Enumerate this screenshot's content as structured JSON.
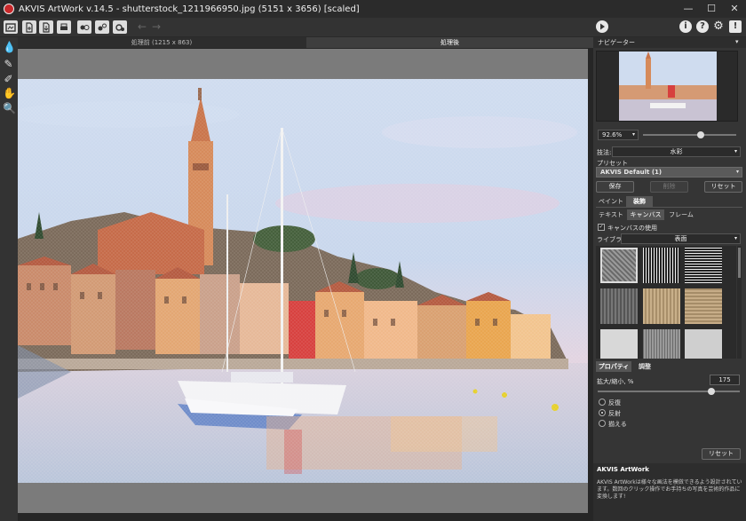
{
  "window": {
    "title": "AKVIS ArtWork v.14.5 - shutterstock_1211966950.jpg (5151 x 3656) [scaled]",
    "minimize": "—",
    "maximize": "☐",
    "close": "✕"
  },
  "toolbar": {
    "back_label": "←",
    "forward_label": "→",
    "right_buttons": [
      "i",
      "?",
      "⚙",
      "!"
    ]
  },
  "view_tabs": {
    "before": "処理前 (1215 x 863)",
    "after": "処理後"
  },
  "navigator": {
    "title": "ナビゲーター",
    "zoom": "92.6%",
    "zoom_fraction": 0.62
  },
  "settings": {
    "method_label": "技法:",
    "method_value": "水彩",
    "preset_label": "プリセット",
    "preset_value": "AKVIS Default (1)",
    "save_label": "保存",
    "delete_label": "削除",
    "reset_label": "リセット",
    "tabs": [
      "ペイント",
      "装飾"
    ],
    "subtabs": [
      "テキスト",
      "キャンバス",
      "フレーム"
    ],
    "use_canvas": "キャンバスの使用",
    "library_label": "ライブラリ",
    "library_value": "表面",
    "props_tabs": [
      "プロパティ",
      "調整"
    ],
    "scale_label": "拡大/縮小, %",
    "scale_value": "175",
    "scale_fraction": 0.8,
    "radio_options": [
      "反復",
      "反射",
      "揃える"
    ],
    "radio_selected": 1,
    "bottom_reset": "リセット"
  },
  "info": {
    "title": "AKVIS ArtWork",
    "text": "AKVIS ArtWorkは様々な画法を模倣できるよう設計されています。数回のクリック操作でお手持ちの写真を芸術的作品に変換します!"
  },
  "colors": {
    "accent_blue": "#2f6bd6",
    "brand_red": "#c8282a"
  }
}
